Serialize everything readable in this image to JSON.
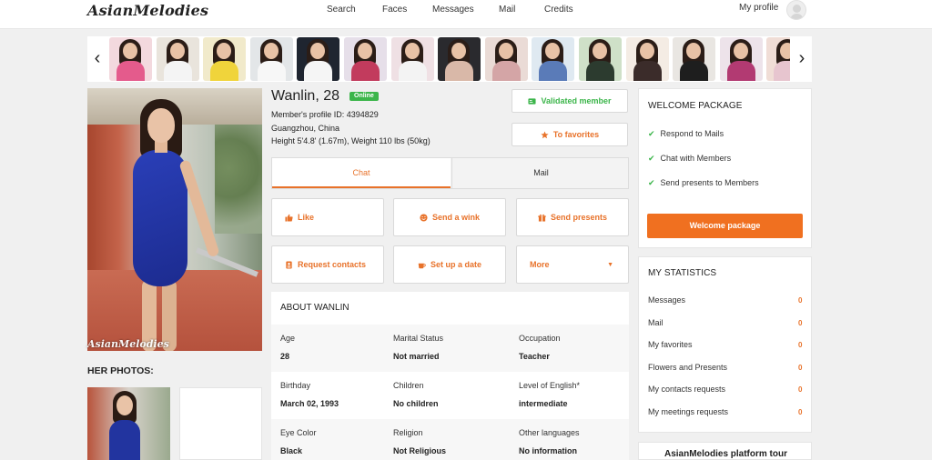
{
  "header": {
    "logo": "AsianMelodies",
    "nav": [
      "Search",
      "Faces",
      "Messages",
      "Mail",
      "Credits"
    ],
    "my_profile": "My profile"
  },
  "carousel": {
    "prev_icon": "chevron-left-icon",
    "next_icon": "chevron-right-icon",
    "thumb_count": 15
  },
  "profile": {
    "name": "Wanlin, 28",
    "status": "Online",
    "profile_id": "Member's profile ID: 4394829",
    "location": "Guangzhou, China",
    "height_weight": "Height 5'4.8' (1.67m), Weight 110 lbs (50kg)",
    "photo_watermark": "AsianMelodies",
    "validated": "Validated member",
    "favorites": "To favorites"
  },
  "her_photos": "HER PHOTOS:",
  "tabs": {
    "chat": "Chat",
    "mail": "Mail"
  },
  "actions": {
    "like": "Like",
    "wink": "Send a wink",
    "presents": "Send presents",
    "contacts": "Request contacts",
    "date": "Set up a date",
    "more": "More"
  },
  "about": {
    "title": "ABOUT WANLIN",
    "rows": [
      [
        {
          "label": "Age",
          "value": "28"
        },
        {
          "label": "Marital Status",
          "value": "Not married"
        },
        {
          "label": "Occupation",
          "value": "Teacher"
        }
      ],
      [
        {
          "label": "Birthday",
          "value": "March 02, 1993"
        },
        {
          "label": "Children",
          "value": "No children"
        },
        {
          "label": "Level of English*",
          "value": "intermediate"
        }
      ],
      [
        {
          "label": "Eye Color",
          "value": "Black"
        },
        {
          "label": "Religion",
          "value": "Not Religious"
        },
        {
          "label": "Other languages",
          "value": "No information"
        }
      ]
    ]
  },
  "welcome": {
    "title": "WELCOME PACKAGE",
    "items": [
      "Respond to Mails",
      "Chat with Members",
      "Send presents to Members"
    ],
    "button": "Welcome package"
  },
  "stats": {
    "title": "MY STATISTICS",
    "items": [
      {
        "label": "Messages",
        "value": "0"
      },
      {
        "label": "Mail",
        "value": "0"
      },
      {
        "label": "My favorites",
        "value": "0"
      },
      {
        "label": "Flowers and Presents",
        "value": "0"
      },
      {
        "label": "My contacts requests",
        "value": "0"
      },
      {
        "label": "My meetings requests",
        "value": "0"
      }
    ]
  },
  "tour": {
    "title": "AsianMelodies platform tour"
  },
  "colors": {
    "accent": "#e8722a",
    "button": "#f07020",
    "online": "#3bb54a"
  }
}
